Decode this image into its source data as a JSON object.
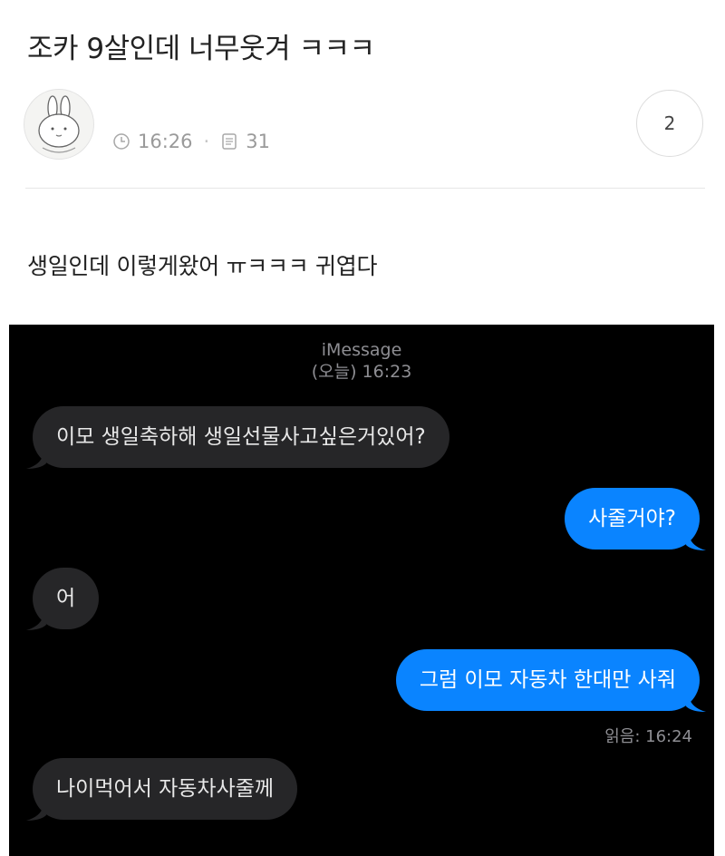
{
  "post": {
    "title": "조카 9살인데 너무웃겨 ㅋㅋㅋ",
    "time": "16:26",
    "views": "31",
    "comment_count": "2",
    "body": "생일인데 이렇게왔어 ㅠㅋㅋㅋ 귀엽다"
  },
  "imessage": {
    "service": "iMessage",
    "timestamp": "(오늘) 16:23",
    "messages": [
      {
        "direction": "in",
        "text": "이모 생일축하해 생일선물사고싶은거있어?"
      },
      {
        "direction": "out",
        "text": "사줄거야?"
      },
      {
        "direction": "in",
        "text": "어"
      },
      {
        "direction": "out",
        "text": "그럼 이모 자동차 한대만 사줘"
      },
      {
        "direction": "in",
        "text": "나이먹어서 자동차사줄께"
      }
    ],
    "read_receipt": "읽음: 16:24"
  },
  "colors": {
    "incoming_bubble": "#262628",
    "outgoing_bubble": "#0a84ff",
    "chat_background": "#000000"
  },
  "icons": [
    "avatar-bunny",
    "clock-icon",
    "views-icon"
  ]
}
